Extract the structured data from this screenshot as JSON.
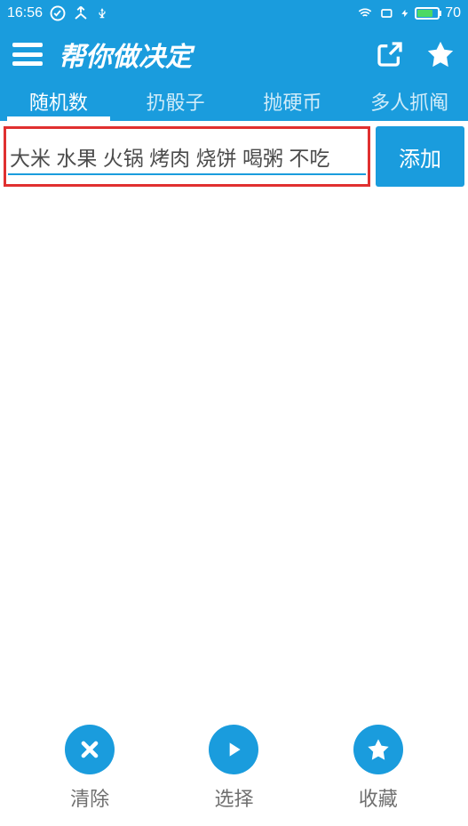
{
  "status_bar": {
    "time": "16:56",
    "battery_level": "70"
  },
  "header": {
    "title": "帮你做决定"
  },
  "tabs": [
    {
      "label": "随机数",
      "active": true
    },
    {
      "label": "扔骰子",
      "active": false
    },
    {
      "label": "抛硬币",
      "active": false
    },
    {
      "label": "多人抓阄",
      "active": false
    }
  ],
  "input": {
    "value": "大米 水果 火锅 烤肉 烧饼 喝粥 不吃",
    "add_label": "添加"
  },
  "bottom_actions": {
    "clear": "清除",
    "choose": "选择",
    "favorite": "收藏"
  }
}
